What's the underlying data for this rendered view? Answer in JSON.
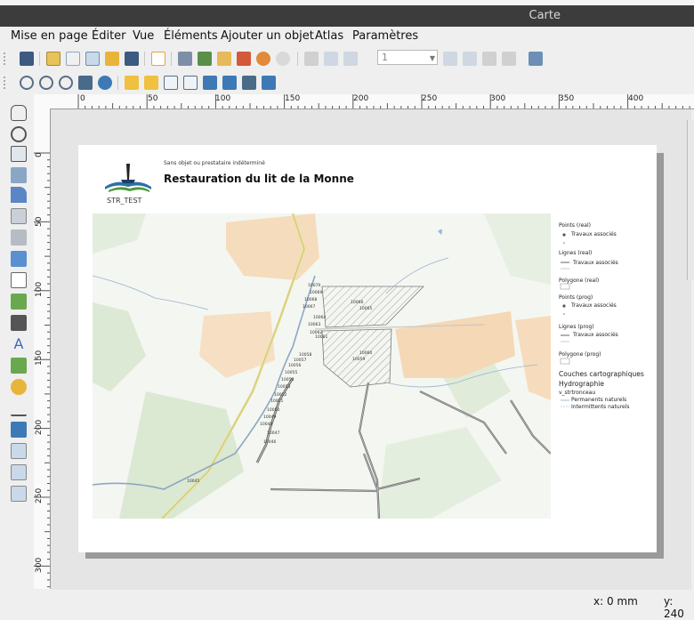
{
  "window": {
    "title": "Carte"
  },
  "menu": [
    "Mise en page",
    "Éditer",
    "Vue",
    "Éléments",
    "Ajouter un objet",
    "Atlas",
    "Paramètres"
  ],
  "atlas_page": "1",
  "ruler": {
    "h_labels": [
      "0",
      "50",
      "100",
      "150",
      "200",
      "250",
      "300",
      "350",
      "400"
    ],
    "v_labels": [
      "0",
      "50",
      "100",
      "150",
      "200",
      "250",
      "300"
    ]
  },
  "layout": {
    "subtitle": "Sans objet ou prestataire indéterminé",
    "title": "Restauration du lit de la Monne",
    "logo_text": "STR_TEST"
  },
  "map_labels": [
    "10070",
    "10069",
    "10068",
    "10067",
    "10066",
    "10065",
    "10064",
    "10063",
    "10062",
    "10061",
    "10060",
    "10059",
    "10058",
    "10057",
    "10056",
    "10055",
    "10054",
    "10053",
    "10052",
    "10051",
    "10050",
    "10049",
    "10048",
    "10047",
    "10046",
    "10045"
  ],
  "legend": {
    "points_real": "Points (real)",
    "points_real_item": "Travaux associés",
    "lines_real": "Lignes (real)",
    "lines_real_item": "Travaux associés",
    "polygon_real": "Polygone (real)",
    "points_prog": "Points (prog)",
    "points_prog_item": "Travaux associés",
    "lines_prog": "Lignes (prog)",
    "lines_prog_item": "Travaux associés",
    "polygon_prog": "Polygone (prog)",
    "couches": "Couches cartographiques",
    "hydrographie": "Hydrographie",
    "v_str": "v_strtronceau",
    "permanents": "Permanents naturels",
    "intermittents": "Intermittents naturels"
  },
  "status": {
    "x": "x: 0 mm",
    "y": "y: 240"
  },
  "colors": {
    "titlebar": "#3c3c3c",
    "canvas": "#e5e5e5",
    "water": "#8fa8c4",
    "hatch": "#999999",
    "green": "#d7e6cf",
    "farm": "#f5d9b8"
  }
}
